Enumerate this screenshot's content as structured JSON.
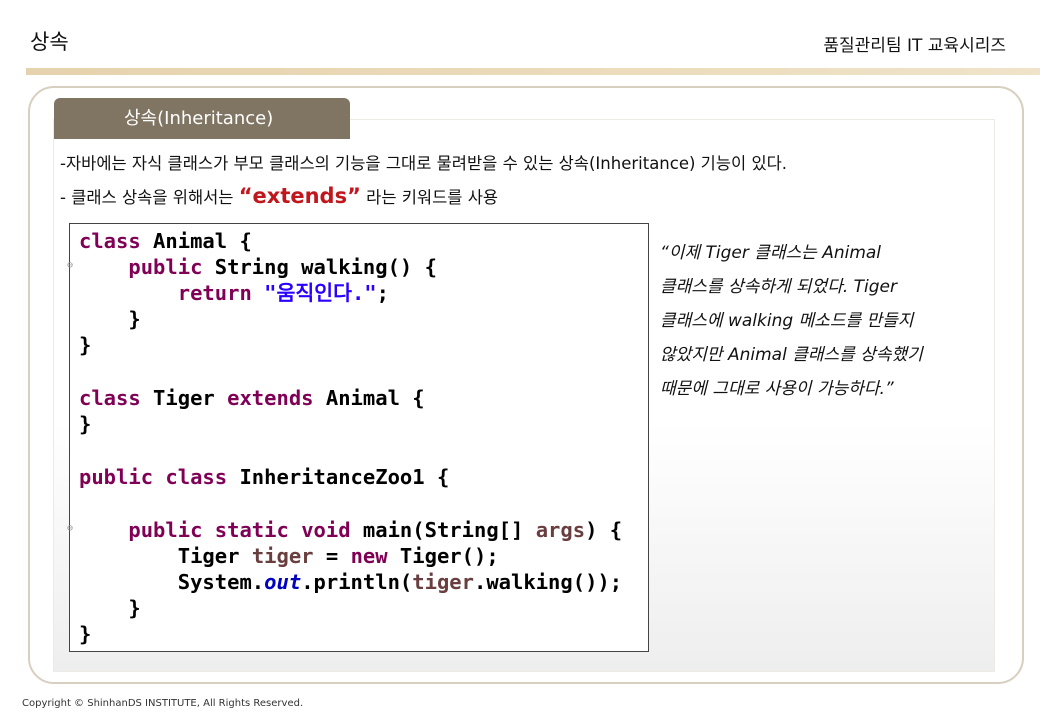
{
  "header": {
    "title": "상속",
    "series": "품질관리팀 IT 교육시리즈"
  },
  "section": {
    "tab_label": "상속(Inheritance)"
  },
  "bullets": [
    {
      "prefix": "-자바에는 자식 클래스가 부모 클래스의 기능을 그대로 물려받을 수 있는 상속(Inheritance) 기능이 있다."
    },
    {
      "prefix": "- 클래스 상속을 위해서는 ",
      "keyword": "“extends”",
      "suffix": " 라는 키워드를 사용"
    }
  ],
  "code": {
    "lines": [
      [
        "class",
        " Animal {"
      ],
      [
        "public",
        " String walking() {"
      ],
      [
        "return",
        "\"움직인다.\"",
        ";"
      ],
      [
        "}"
      ],
      [
        "}"
      ],
      [
        "class",
        " Tiger ",
        "extends",
        " Animal {"
      ],
      [
        "}"
      ],
      [
        "public",
        "class",
        " InheritanceZoo1 {"
      ],
      [
        "public",
        "static",
        "void",
        " main(String[] ",
        "args",
        ") {"
      ],
      [
        " Tiger ",
        "tiger",
        " = ",
        "new",
        " Tiger();"
      ],
      [
        " System.",
        "out",
        ".println(",
        "tiger",
        ".walking());"
      ],
      [
        "}"
      ],
      [
        "}"
      ]
    ]
  },
  "note": {
    "lines": [
      "“이제  Tiger 클래스는 Animal",
      "클래스를 상속하게 되었다. Tiger",
      "클래스에  walking 메소드를 만들지",
      "않았지만 Animal 클래스를 상속했기",
      "때문에 그대로 사용이 가능하다.”"
    ]
  },
  "footer": {
    "copyright": "Copyright © ShinhanDS INSTITUTE, All Rights Reserved."
  },
  "colors": {
    "tab_bg": "#7f7562",
    "header_rule": "#e6d2ad",
    "keyword_red": "#c0161c",
    "java_keyword": "#7f0055",
    "java_string": "#2a00ff",
    "java_field": "#0000c0",
    "java_local": "#6a3e3e"
  }
}
